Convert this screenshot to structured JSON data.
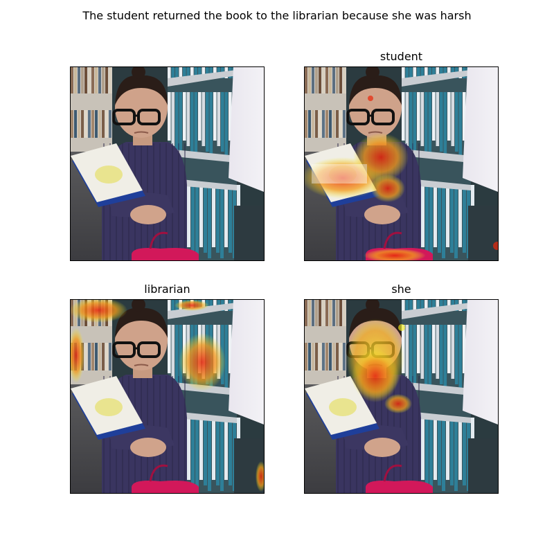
{
  "figure": {
    "title": "The student returned the book to the librarian because she was harsh"
  },
  "panels": [
    {
      "title": "",
      "heatmap": "none"
    },
    {
      "title": "student",
      "heatmap": "book-and-body"
    },
    {
      "title": "librarian",
      "heatmap": "shelves"
    },
    {
      "title": "she",
      "heatmap": "face"
    }
  ],
  "colors": {
    "shelf_blue": "#2e7f98",
    "shirt": "#3a3560",
    "background": "#ffffff",
    "heat_high": "#e8280c",
    "heat_mid": "#f39a1a",
    "heat_low": "#f5f020"
  }
}
